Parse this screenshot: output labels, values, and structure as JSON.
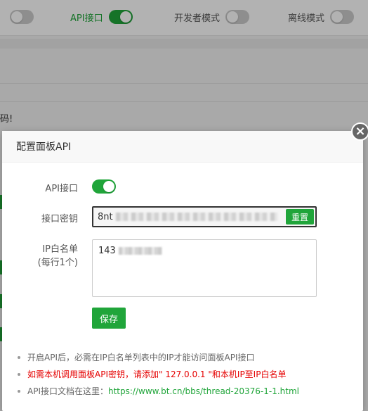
{
  "background": {
    "settings": [
      {
        "label": "",
        "on": false
      },
      {
        "label": "API接口",
        "on": true
      },
      {
        "label": "开发者模式",
        "on": false
      },
      {
        "label": "离线模式",
        "on": false
      }
    ],
    "left_text": "码!"
  },
  "dialog": {
    "title": "配置面板API",
    "close_symbol": "×",
    "api_label": "API接口",
    "api_enabled": true,
    "key_label": "接口密钥",
    "key_value": "8nt",
    "reset_label": "重置",
    "whitelist_label_line1": "IP白名单",
    "whitelist_label_line2": "(每行1个)",
    "whitelist_value": "143",
    "save_label": "保存",
    "notes": [
      {
        "text": "开启API后，必需在IP白名单列表中的IP才能访问面板API接口",
        "color": "#666666"
      },
      {
        "text": "如需本机调用面板API密钥，请添加\" 127.0.0.1 \"和本机IP至IP白名单",
        "color": "#e50000"
      },
      {
        "prefix": "API接口文档在这里：",
        "link": "https://www.bt.cn/bbs/thread-20376-1-1.html",
        "color": "#20a53a"
      }
    ]
  }
}
